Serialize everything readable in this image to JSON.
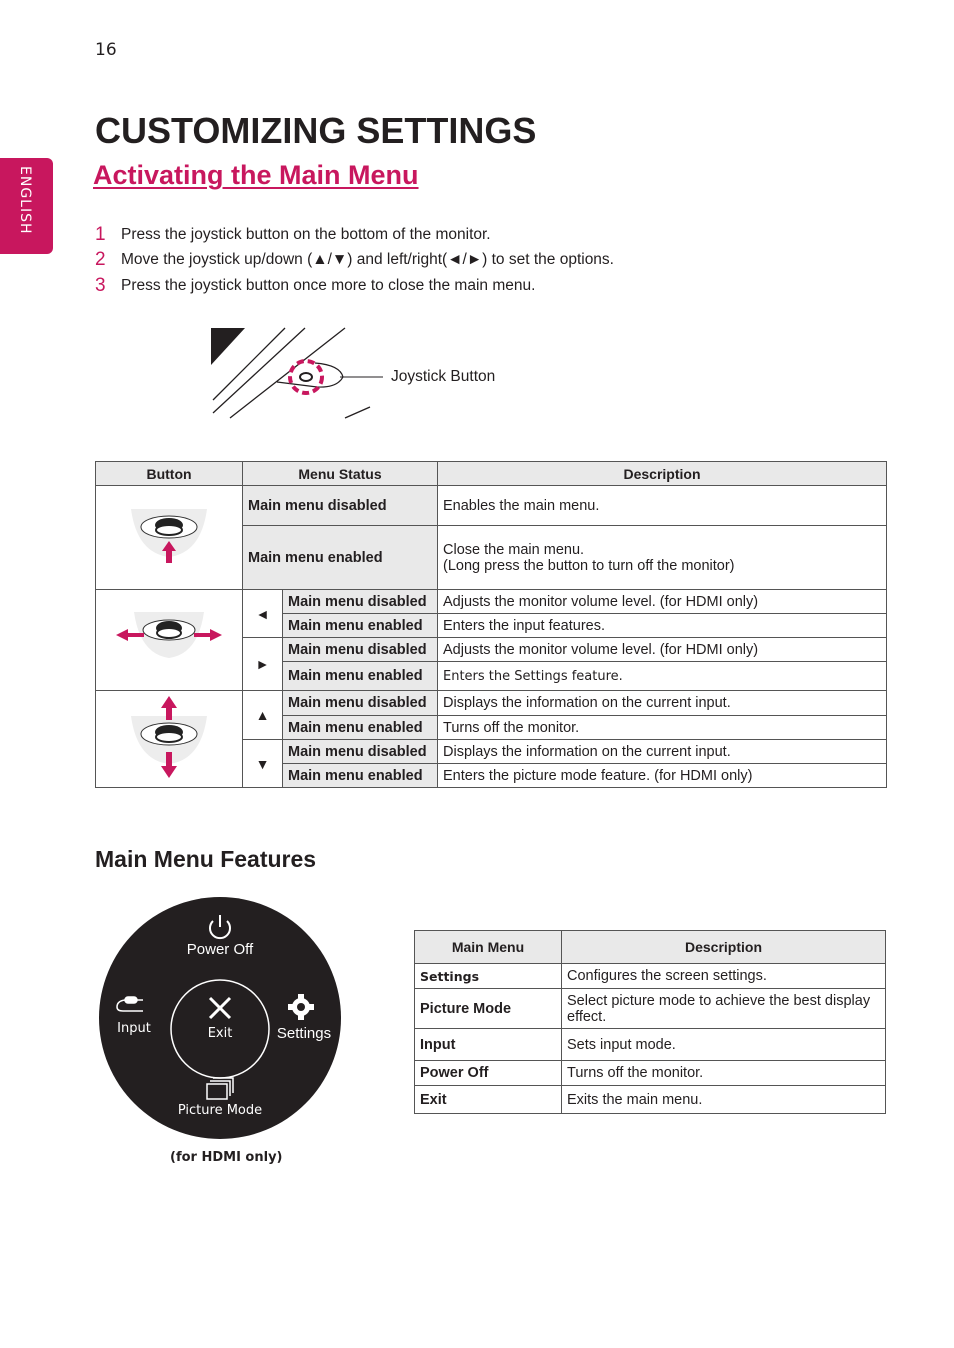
{
  "page_number": "16",
  "language_tab": "ENGLISH",
  "title": "CUSTOMIZING SETTINGS",
  "section_title": "Activating the Main Menu",
  "steps": [
    {
      "num": "1",
      "text": "Press the joystick button on the bottom of the monitor."
    },
    {
      "num": "2",
      "text": "Move the joystick up/down (▲/▼) and left/right(◄/►) to set the options."
    },
    {
      "num": "3",
      "text": "Press the joystick button once more to close the main menu."
    }
  ],
  "joystick_label": "Joystick Button",
  "button_table": {
    "headers": [
      "Button",
      "Menu Status",
      "Description"
    ],
    "groups": [
      {
        "button_icon": "joystick-press-icon",
        "rows": [
          {
            "status": "Main menu disabled",
            "description": "Enables the main menu."
          },
          {
            "status": "Main menu enabled",
            "description": "Close the main menu.",
            "description2": "(Long press the button to turn off the monitor)"
          }
        ]
      },
      {
        "button_icon": "joystick-left-right-icon",
        "directions": [
          {
            "arrow": "◄",
            "rows": [
              {
                "status": "Main menu disabled",
                "description": "Adjusts the monitor volume level. (for HDMI only)"
              },
              {
                "status": "Main menu enabled",
                "description": "Enters the input features."
              }
            ]
          },
          {
            "arrow": "►",
            "rows": [
              {
                "status": "Main menu disabled",
                "description": "Adjusts the monitor volume level. (for HDMI only)"
              },
              {
                "status": "Main menu enabled",
                "description": "Enters the Settings feature."
              }
            ]
          }
        ]
      },
      {
        "button_icon": "joystick-up-down-icon",
        "directions": [
          {
            "arrow": "▲",
            "rows": [
              {
                "status": "Main menu disabled",
                "description": "Displays the information on the current input."
              },
              {
                "status": "Main menu enabled",
                "description": "Turns off the monitor."
              }
            ]
          },
          {
            "arrow": "▼",
            "rows": [
              {
                "status": "Main menu disabled",
                "description": "Displays the information on the current input."
              },
              {
                "status": "Main menu enabled",
                "description": "Enters the picture mode feature. (for HDMI only)"
              }
            ]
          }
        ]
      }
    ]
  },
  "features_title": "Main Menu Features",
  "menu_wheel": {
    "top": "Power Off",
    "left": "Input",
    "center": "Exit",
    "right": "Settings",
    "bottom": "Picture Mode",
    "note": "(for HDMI only)"
  },
  "menu_table": {
    "headers": [
      "Main Menu",
      "Description"
    ],
    "rows": [
      {
        "menu": "Settings",
        "description": "Configures the screen settings."
      },
      {
        "menu": "Picture Mode",
        "description": "Select picture mode to achieve the best display effect."
      },
      {
        "menu": "Input",
        "description": "Sets input mode."
      },
      {
        "menu": "Power Off",
        "description": "Turns off the monitor."
      },
      {
        "menu": "Exit",
        "description": "Exits the main menu."
      }
    ]
  },
  "colors": {
    "accent": "#c8175e",
    "header_bg": "#e9e9e9",
    "wheel_bg": "#231f20"
  }
}
